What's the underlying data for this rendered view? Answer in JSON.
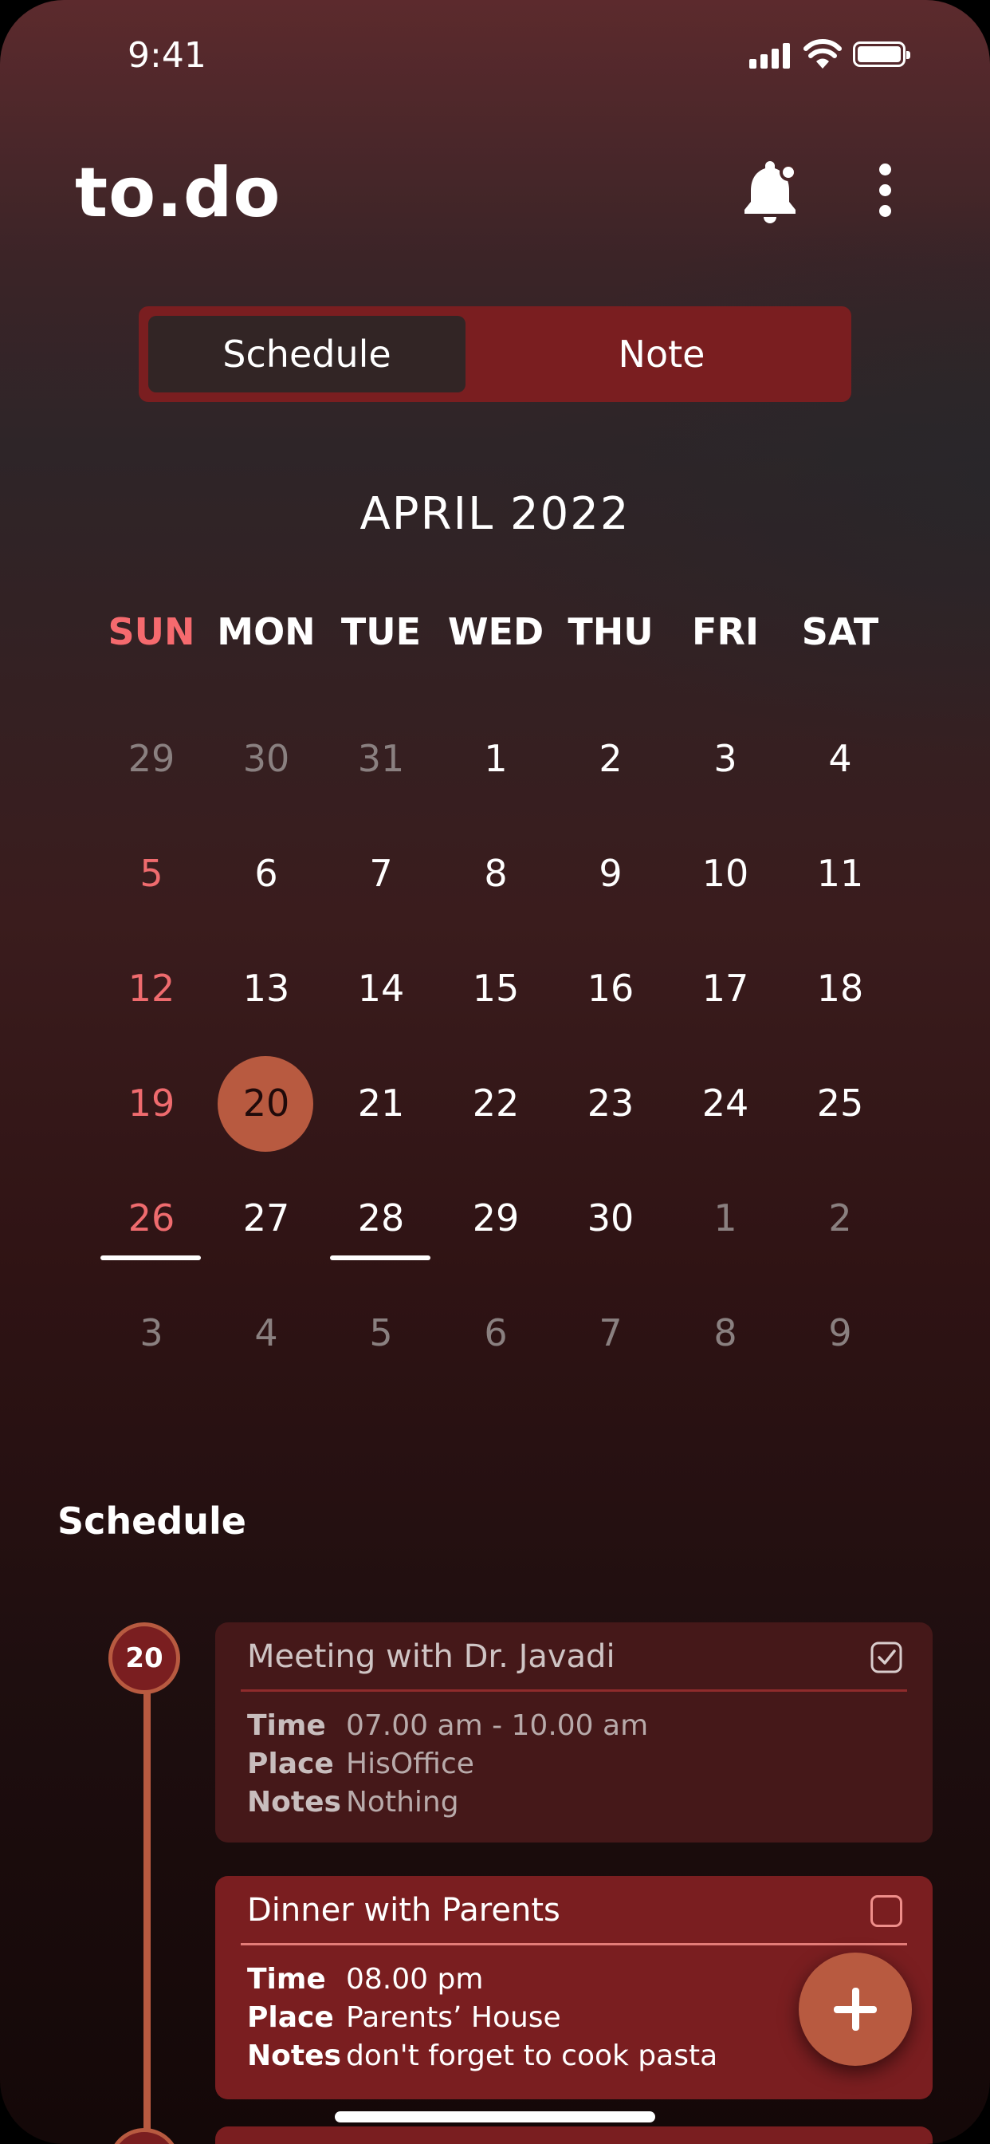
{
  "status": {
    "time": "9:41"
  },
  "app": {
    "title": "to.do"
  },
  "header": {
    "icons": [
      "bell-notification-icon",
      "more-vertical-icon"
    ]
  },
  "tabs": {
    "schedule": "Schedule",
    "note": "Note",
    "active": "Schedule"
  },
  "calendar": {
    "month": "APRIL 2022",
    "weekdays": [
      "SUN",
      "MON",
      "TUE",
      "WED",
      "THU",
      "FRI",
      "SAT"
    ],
    "weeks": [
      [
        "29",
        "30",
        "31",
        "1",
        "2",
        "3",
        "4"
      ],
      [
        "5",
        "6",
        "7",
        "8",
        "9",
        "10",
        "11"
      ],
      [
        "12",
        "13",
        "14",
        "15",
        "16",
        "17",
        "18"
      ],
      [
        "19",
        "20",
        "21",
        "22",
        "23",
        "24",
        "25"
      ],
      [
        "26",
        "27",
        "28",
        "29",
        "30",
        "1",
        "2"
      ],
      [
        "3",
        "4",
        "5",
        "6",
        "7",
        "8",
        "9"
      ]
    ],
    "selected_day": "20",
    "underlined_days": [
      "26",
      "28"
    ]
  },
  "schedule": {
    "heading": "Schedule",
    "date_badge": "20",
    "labels": {
      "time": "Time",
      "place": "Place",
      "notes": "Notes"
    },
    "items": [
      {
        "title": "Meeting with Dr. Javadi",
        "time": "07.00 am - 10.00 am",
        "place": "HisOffice",
        "notes": "Nothing",
        "checked": true
      },
      {
        "title": "Dinner with  Parents",
        "time": "08.00 pm",
        "place": "Parents’ House",
        "notes": "don't forget to cook pasta",
        "checked": false
      }
    ]
  },
  "colors": {
    "accent": "#b85a40",
    "card": "#7a1e20",
    "sunday": "#f56a6e"
  }
}
